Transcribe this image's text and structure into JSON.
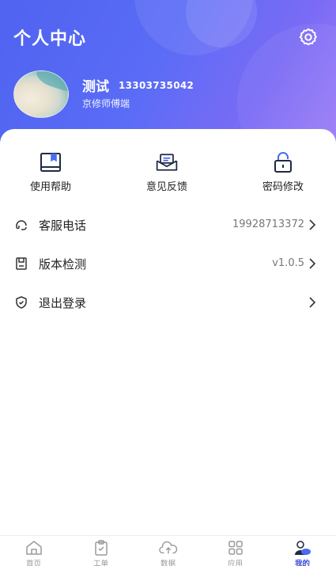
{
  "header": {
    "title": "个人中心",
    "settings_icon": "gear-icon",
    "accent": "#5a6cf6"
  },
  "profile": {
    "name": "测试",
    "phone": "13303735042",
    "role": "京修师傅端"
  },
  "quick_actions": [
    {
      "label": "使用帮助",
      "icon": "book-icon"
    },
    {
      "label": "意见反馈",
      "icon": "envelope-icon"
    },
    {
      "label": "密码修改",
      "icon": "lock-icon"
    }
  ],
  "menu": [
    {
      "label": "客服电话",
      "value": "19928713372",
      "icon": "headset-icon"
    },
    {
      "label": "版本检测",
      "value": "v1.0.5",
      "icon": "save-icon"
    },
    {
      "label": "退出登录",
      "value": "",
      "icon": "shield-icon"
    }
  ],
  "tabbar": [
    {
      "label": "首页",
      "icon": "home-icon"
    },
    {
      "label": "工单",
      "icon": "clipboard-icon"
    },
    {
      "label": "数据",
      "icon": "cloud-upload-icon"
    },
    {
      "label": "应用",
      "icon": "grid-icon"
    },
    {
      "label": "我的",
      "icon": "user-icon",
      "active": true
    }
  ]
}
